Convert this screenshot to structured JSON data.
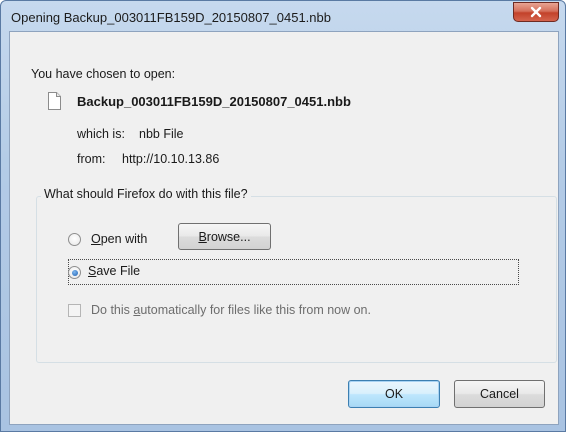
{
  "window": {
    "title": "Opening Backup_003011FB159D_20150807_0451.nbb"
  },
  "dialog": {
    "intro": "You have chosen to open:",
    "file_name": "Backup_003011FB159D_20150807_0451.nbb",
    "which_is_label": "which is:",
    "which_is_value": "nbb File",
    "from_label": "from:",
    "from_value": "http://10.10.13.86",
    "group_title": "What should Firefox do with this file?",
    "open_with": {
      "pre": "",
      "accel": "O",
      "post": "pen with",
      "checked": false
    },
    "browse_button": {
      "pre": "",
      "accel": "B",
      "post": "rowse...",
      "enabled": true
    },
    "save_file": {
      "pre": "",
      "accel": "S",
      "post": "ave File",
      "checked": true
    },
    "auto_checkbox": {
      "pre": "Do this ",
      "accel": "a",
      "post": "utomatically for files like this from now on.",
      "checked": false,
      "enabled": false
    },
    "ok_label": "OK",
    "cancel_label": "Cancel"
  },
  "icons": {
    "close": "close-x-icon",
    "file": "file-document-icon"
  },
  "colors": {
    "titlebar": "#b3cbe6",
    "close_button": "#c3422a",
    "client_bg": "#f0f0f0",
    "radio_selected": "#1c5fb0"
  }
}
